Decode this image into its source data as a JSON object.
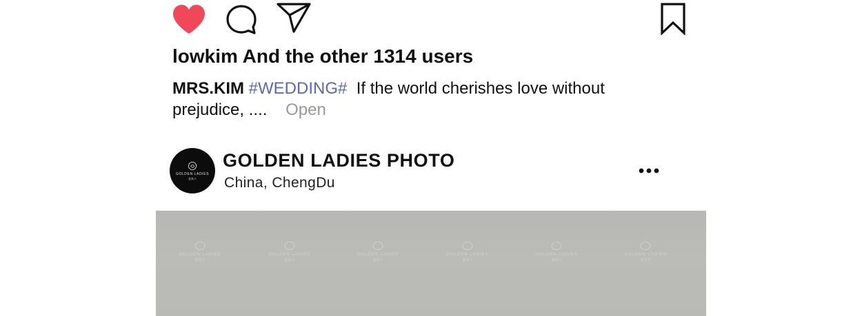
{
  "actions": {
    "like_icon": "heart-icon",
    "comment_icon": "comment-icon",
    "share_icon": "paper-plane-icon",
    "save_icon": "bookmark-icon",
    "like_color": "#f0485a"
  },
  "likes": {
    "text": "lowkim And the other 1314 users"
  },
  "caption": {
    "username": "MRS.KIM",
    "hashtag": "#WEDDING#",
    "text": "If the world cherishes love without prejudice, ....",
    "more_label": "Open"
  },
  "post": {
    "account_name": "GOLDEN LADIES PHOTO",
    "location": "China,  ChengDu",
    "avatar": {
      "brand": "GOLDEN LADIES",
      "sub": "金夫人"
    },
    "more_icon": "more-horizontal-icon"
  },
  "photo": {
    "watermark_text": "GOLDEN LADIES",
    "watermark_sub": "金夫人"
  }
}
